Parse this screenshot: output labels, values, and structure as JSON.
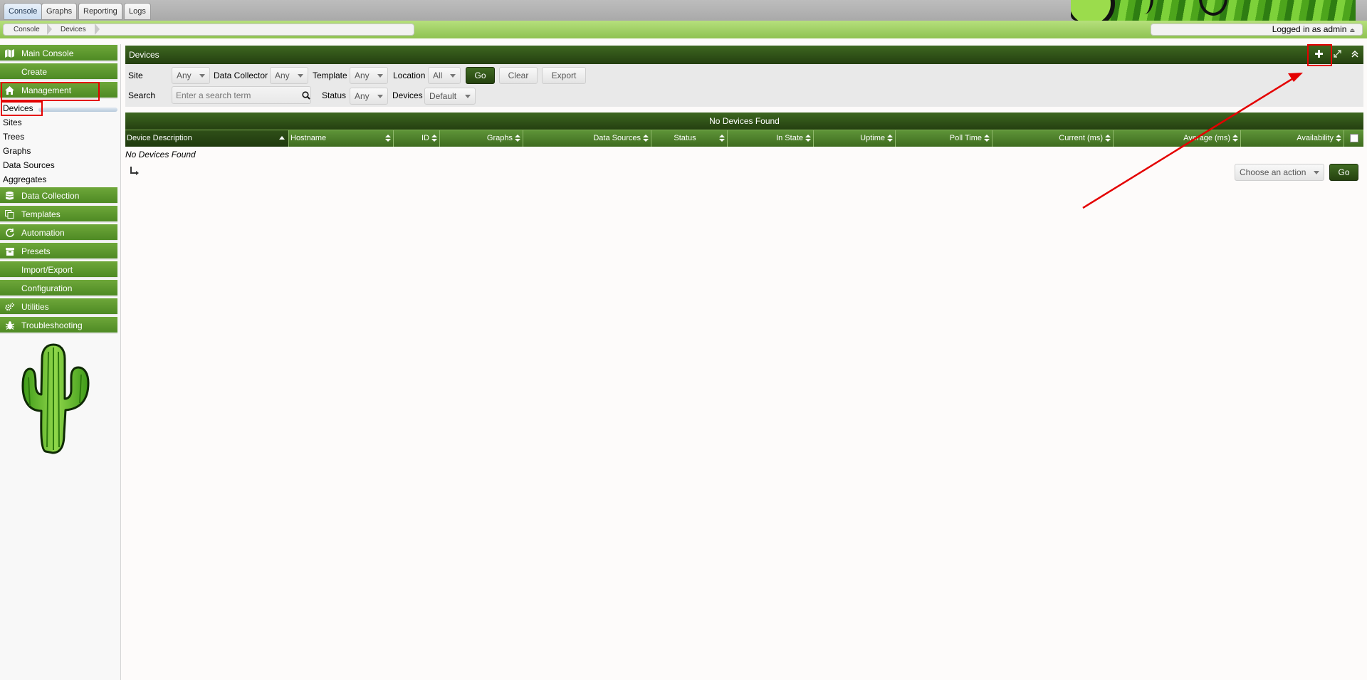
{
  "topbar": {
    "tabs": [
      {
        "label": "Console",
        "active": true
      },
      {
        "label": "Graphs",
        "active": false
      },
      {
        "label": "Reporting",
        "active": false
      },
      {
        "label": "Logs",
        "active": false
      }
    ]
  },
  "breadcrumb": {
    "items": [
      "Console",
      "Devices"
    ]
  },
  "user": {
    "status_text": "Logged in as admin"
  },
  "sidebar": {
    "headers": [
      {
        "label": "Main Console",
        "icon": "map-icon"
      },
      {
        "label": "Create",
        "icon": ""
      },
      {
        "label": "Management",
        "icon": "home-icon"
      },
      {
        "label": "Data Collection",
        "icon": "database-icon"
      },
      {
        "label": "Templates",
        "icon": "copy-icon"
      },
      {
        "label": "Automation",
        "icon": "refresh-icon"
      },
      {
        "label": "Presets",
        "icon": "archive-icon"
      },
      {
        "label": "Import/Export",
        "icon": ""
      },
      {
        "label": "Configuration",
        "icon": ""
      },
      {
        "label": "Utilities",
        "icon": "gears-icon"
      },
      {
        "label": "Troubleshooting",
        "icon": "bug-icon"
      }
    ],
    "management_items": [
      "Devices",
      "Sites",
      "Trees",
      "Graphs",
      "Data Sources",
      "Aggregates"
    ],
    "selected_item": "Devices"
  },
  "panel": {
    "title": "Devices",
    "header_buttons": [
      "add-icon",
      "expand-icon",
      "collapse-icon"
    ]
  },
  "filters": {
    "site": {
      "label": "Site",
      "value": "Any"
    },
    "data_collector": {
      "label": "Data Collector",
      "value": "Any"
    },
    "template": {
      "label": "Template",
      "value": "Any"
    },
    "location": {
      "label": "Location",
      "value": "All"
    },
    "go_label": "Go",
    "clear_label": "Clear",
    "export_label": "Export",
    "search": {
      "label": "Search",
      "placeholder": "Enter a search term",
      "value": ""
    },
    "status": {
      "label": "Status",
      "value": "Any"
    },
    "devices": {
      "label": "Devices",
      "value": "Default"
    }
  },
  "table": {
    "caption": "No Devices Found",
    "columns": [
      "Device Description",
      "Hostname",
      "ID",
      "Graphs",
      "Data Sources",
      "Status",
      "In State",
      "Uptime",
      "Poll Time",
      "Current (ms)",
      "Average (ms)",
      "Availability"
    ],
    "sorted_column": "Device Description",
    "sort_direction": "ascending",
    "empty_message": "No Devices Found"
  },
  "actions": {
    "select_value": "Choose an action",
    "go_label": "Go"
  },
  "colors": {
    "header_dark_green": "#2f531a",
    "menu_green": "#5e9a30",
    "highlight_red": "#e40000"
  }
}
